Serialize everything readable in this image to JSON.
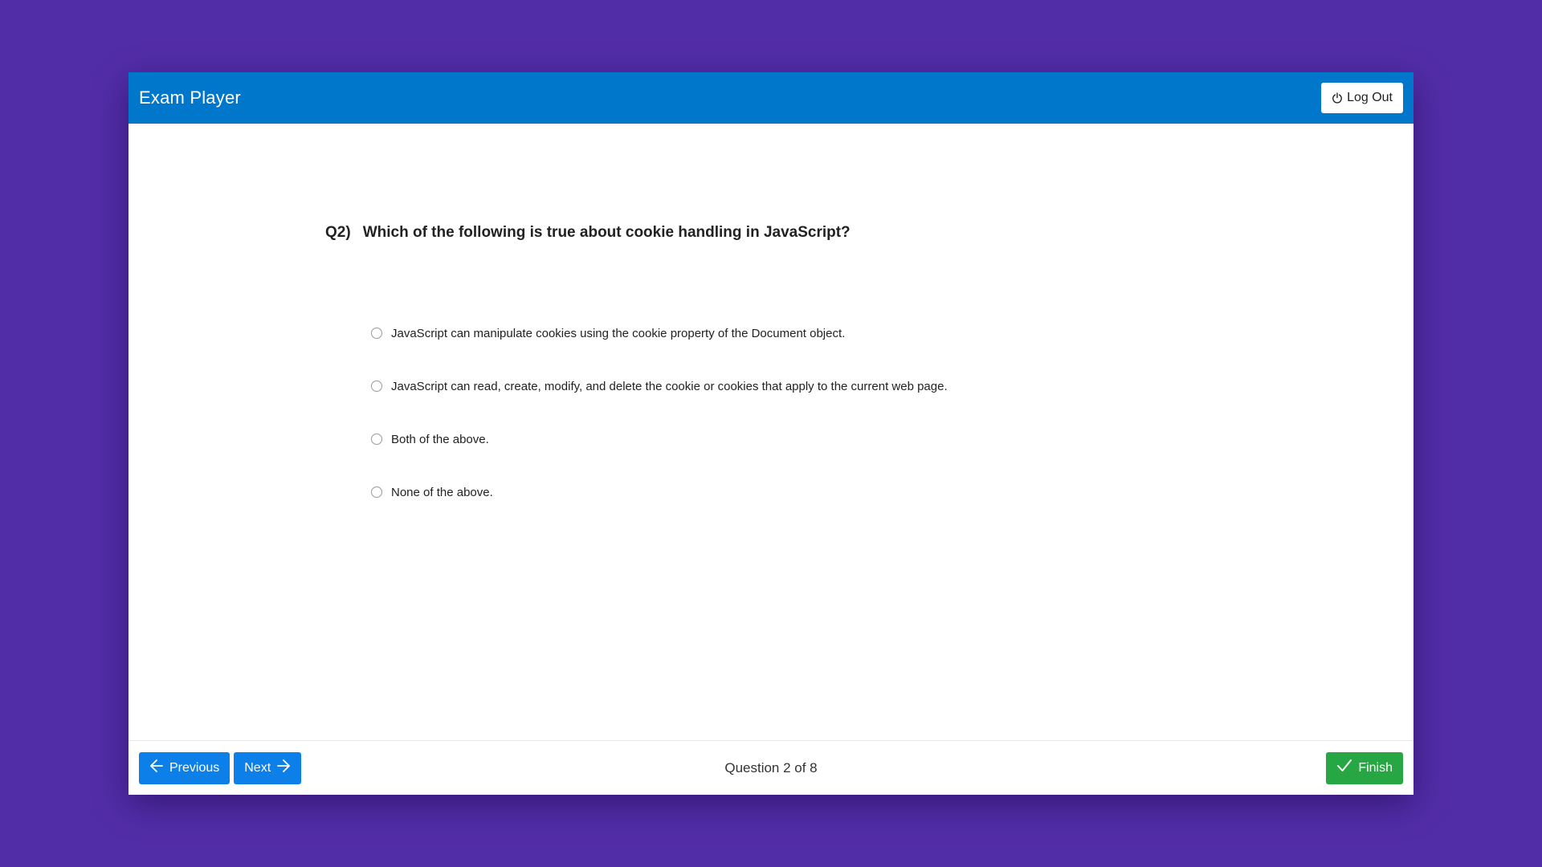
{
  "header": {
    "title": "Exam Player",
    "logout_label": "Log Out"
  },
  "question": {
    "number": "Q2)",
    "text": "Which of the following is true about cookie handling in JavaScript?",
    "options": [
      "JavaScript can manipulate cookies using the cookie property of the Document object.",
      "JavaScript can read, create, modify, and delete the cookie or cookies that apply to the current web page.",
      "Both of the above.",
      "None of the above."
    ]
  },
  "footer": {
    "previous_label": "Previous",
    "next_label": "Next",
    "counter": "Question 2 of 8",
    "finish_label": "Finish"
  },
  "colors": {
    "background": "#522da8",
    "header": "#0177cc",
    "primary": "#0d7fe8",
    "success": "#27a744"
  },
  "icons": {
    "logout": "power-icon",
    "previous": "arrow-left-icon",
    "next": "arrow-right-icon",
    "finish": "check-icon"
  }
}
